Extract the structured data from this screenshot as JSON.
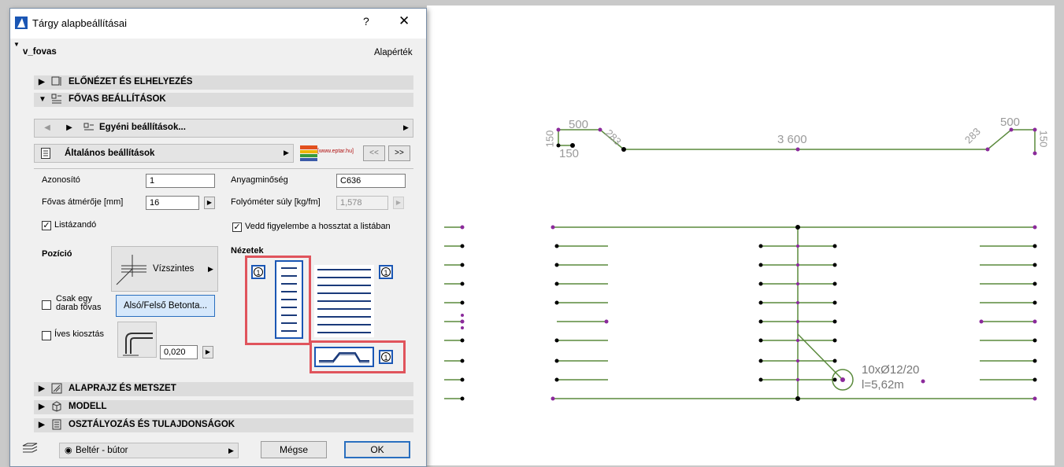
{
  "dialog": {
    "title": "Tárgy alapbeállításai",
    "help": "?",
    "close": "✕",
    "object_name": "v_fovas",
    "default_label": "Alapérték",
    "sections": {
      "preview": "ELŐNÉZET ÉS ELHELYEZÉS",
      "settings": "FŐVAS BEÁLLÍTÁSOK",
      "plan": "ALAPRAJZ ÉS METSZET",
      "model": "MODELL",
      "classification": "OSZTÁLYOZÁS ÉS TULAJDONSÁGOK"
    },
    "custom_settings": "Egyéni beállítások...",
    "general_settings": "Általános beállítások",
    "logo_url": "[www.eptar.hu]",
    "nav_prev": "<<",
    "nav_next": ">>",
    "fields": {
      "id_label": "Azonosító",
      "id_value": "1",
      "material_label": "Anyagminőség",
      "material_value": "C636",
      "diameter_label": "Fővas átmérője [mm]",
      "diameter_value": "16",
      "weight_label": "Folyóméter súly [kg/fm]",
      "weight_value": "1,578",
      "listed_label": "Listázandó",
      "length_label": "Vedd figyelembe a hossztat a listában",
      "position_label": "Pozíció",
      "horizontal_label": "Vízszintes",
      "single_label": "Csak egy darab fővas",
      "bottom_top_button": "Alsó/Felső Betonta...",
      "arc_label": "Íves kiosztás",
      "spacing_value": "0,020",
      "views_label": "Nézetek",
      "view_number": "1"
    },
    "footer": {
      "layer": "Beltér - bútor",
      "cancel": "Mégse",
      "ok": "OK"
    }
  },
  "drawing": {
    "dim_500_left": "500",
    "dim_150_left_v": "150",
    "dim_150_left_h": "150",
    "dim_283_left": "283",
    "dim_3600": "3 600",
    "dim_283_right": "283",
    "dim_500_right": "500",
    "dim_150_right": "150",
    "rebar_count_label": "10xØ12/20",
    "rebar_length_label": "l=5,62m"
  },
  "colors": {
    "rebar_green": "#5a8a3c",
    "marker_purple": "#8b2a9b",
    "highlight_red": "#e0545c",
    "accent_blue": "#1a56b4"
  }
}
